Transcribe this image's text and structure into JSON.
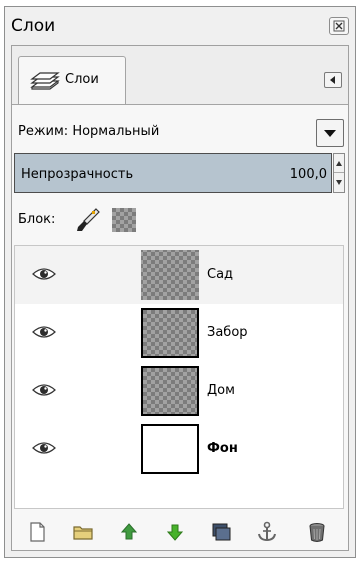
{
  "window": {
    "title": "Слои"
  },
  "tabs": [
    {
      "label": "Слои",
      "icon": "layers-icon"
    }
  ],
  "mode": {
    "label": "Режим:",
    "value": "Нормальный"
  },
  "opacity": {
    "label": "Непрозрачность",
    "value": "100,0"
  },
  "lock": {
    "label": "Блок:"
  },
  "layers": [
    {
      "name": "Сад",
      "visible": true,
      "selected": true,
      "thumb": "transparent",
      "bold": false
    },
    {
      "name": "Забор",
      "visible": true,
      "selected": false,
      "thumb": "transparent",
      "bold": false
    },
    {
      "name": "Дом",
      "visible": true,
      "selected": false,
      "thumb": "transparent",
      "bold": false
    },
    {
      "name": "Фон",
      "visible": true,
      "selected": false,
      "thumb": "white",
      "bold": true
    }
  ],
  "toolbar": {
    "buttons": [
      "new-layer-icon",
      "new-layer-group-icon",
      "raise-layer-icon",
      "lower-layer-icon",
      "duplicate-layer-icon",
      "anchor-layer-icon",
      "delete-layer-icon"
    ]
  },
  "colors": {
    "opacity_bar": "#b6c4cf",
    "raise": "#3f9a3f",
    "lower": "#48b22b",
    "folder": "#e5cf7c"
  }
}
